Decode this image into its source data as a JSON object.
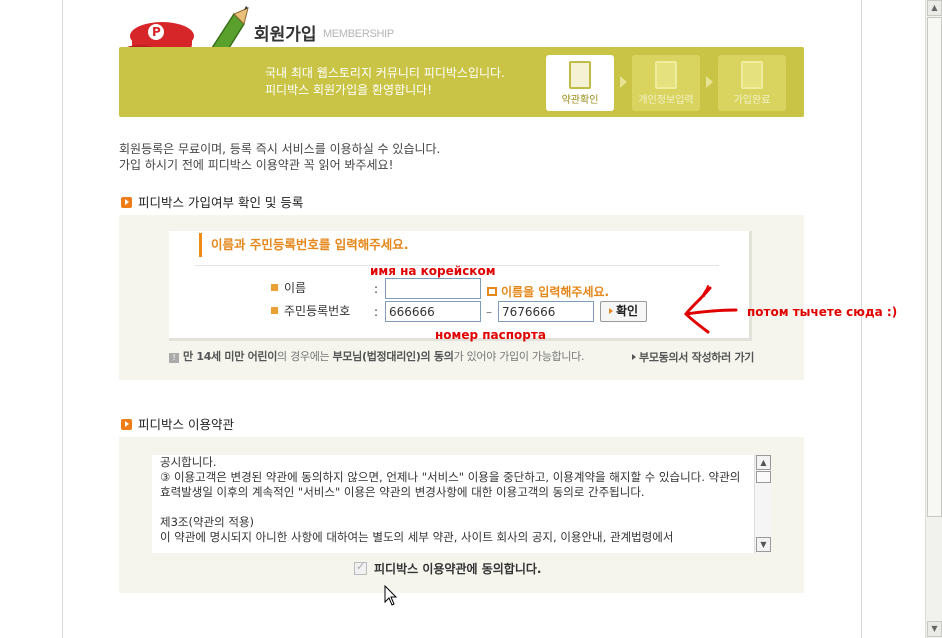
{
  "header": {
    "title": "회원가입",
    "subtitle": "MEMBERSHIP",
    "banner_line1": "국내 최대 웹스토리지 커뮤니티 피디박스입니다.",
    "banner_line2": "피디박스 회원가입을 환영합니다!",
    "steps": [
      {
        "label": "약관확인",
        "active": true,
        "icon": "document-icon"
      },
      {
        "label": "개인정보입력",
        "active": false,
        "icon": "edit-document-icon"
      },
      {
        "label": "가입완료",
        "active": false,
        "icon": "key-document-icon"
      }
    ],
    "mascot_letter": "P"
  },
  "intro": {
    "line1": "회원등록은 무료이며, 등록 즉시 서비스를 이용하실 수 있습니다.",
    "line2": "가입 하시기 전에 피디박스 이용약관 꼭 읽어 봐주세요!"
  },
  "registration": {
    "section_title": "피디박스 가입여부 확인 및 등록",
    "heading": "이름과 주민등록번호를 입력해주세요.",
    "name_label": "이름",
    "name_value": "",
    "name_hint": "이름을 입력해주세요.",
    "id_label": "주민등록번호",
    "id_part1": "666666",
    "id_part2": "7676666",
    "id_separator": "–",
    "colon": ":",
    "confirm_button": "확인",
    "notice_prefix": "만 14세 미만 어린이",
    "notice_mid": "의 경우에는 ",
    "notice_bold": "부모님(법정대리인)의 동의",
    "notice_suffix": "가 있어야 가입이 가능합니다.",
    "parent_link": "부모동의서 작성하러 가기"
  },
  "annotations": {
    "name_note": "имя на корейском",
    "passport_note": "номер паспорта",
    "click_note": "потом тычете сюда :)",
    "color": "#e00000"
  },
  "terms": {
    "section_title": "피디박스 이용약관",
    "paragraphs": [
      "공시합니다.",
      "③ 이용고객은 변경된 약관에 동의하지 않으면, 언제나 \"서비스\" 이용을 중단하고, 이용계약을 해지할 수 있습니다. 약관의 효력발생일 이후의 계속적인 \"서비스\" 이용은 약관의 변경사항에 대한 이용고객의 동의로 간주됩니다.",
      "",
      "제3조(약관의 적용)",
      "이 약관에 명시되지 아니한 사항에 대하여는 별도의 세부 약관, 사이트 회사의 공지, 이용안내, 관계법령에서"
    ],
    "agree_label": "피디박스 이용약관에 동의합니다."
  },
  "colors": {
    "banner": "#c9c445",
    "accent_orange": "#ee7d17",
    "panel_bg": "#f5f5ee"
  }
}
